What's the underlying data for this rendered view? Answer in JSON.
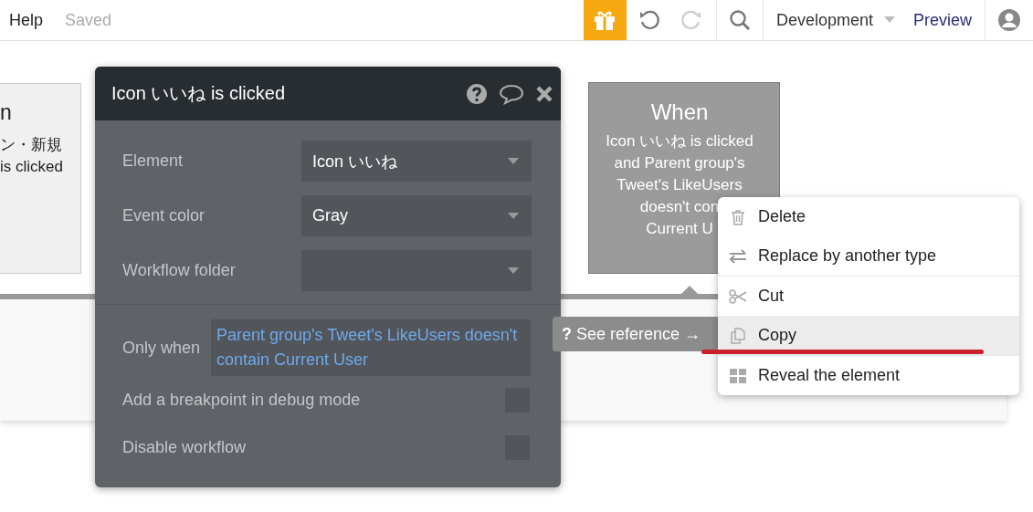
{
  "top_bar": {
    "menu": [
      "Help"
    ],
    "save_status": "Saved",
    "tools": [
      {
        "kind": "gift",
        "disabled": false
      },
      {
        "kind": "undo",
        "disabled": false
      },
      {
        "kind": "redo",
        "disabled": true
      },
      {
        "kind": "search",
        "disabled": false
      }
    ],
    "version_dropdown": "Development",
    "preview_link": "Preview"
  },
  "canvas": {
    "partial_card": {
      "title": "n",
      "lines": [
        "ン・新規",
        "is clicked"
      ]
    },
    "when_card": {
      "title": "When",
      "lines": [
        "Icon いいね is clicked",
        "and Parent group's",
        "Tweet's LikeUsers",
        "doesn't con",
        "Current U"
      ]
    }
  },
  "event_popup": {
    "title": "Icon いいね is clicked",
    "fields": [
      {
        "label": "Element",
        "value": "Icon いいね"
      },
      {
        "label": "Event color",
        "value": "Gray"
      },
      {
        "label": "Workflow folder"
      }
    ],
    "condition": {
      "label": "Only when",
      "value": "Parent group's Tweet's LikeUsers doesn't contain Current User"
    },
    "options": [
      {
        "label": "Add a breakpoint in debug mode",
        "checked": false
      },
      {
        "label": "Disable workflow",
        "checked": false
      }
    ]
  },
  "see_reference": {
    "icon": "?",
    "label": "See reference →"
  },
  "context_menu": [
    {
      "kind": "trash",
      "label": "Delete",
      "selected": false,
      "divider_before": false
    },
    {
      "kind": "swap",
      "label": "Replace by another type",
      "selected": false,
      "divider_before": false
    },
    {
      "kind": "scissors",
      "label": "Cut",
      "selected": false,
      "divider_before": true
    },
    {
      "kind": "copy",
      "label": "Copy",
      "selected": true,
      "divider_before": false
    },
    {
      "kind": "grid",
      "label": "Reveal the element",
      "selected": false,
      "divider_before": true
    }
  ]
}
